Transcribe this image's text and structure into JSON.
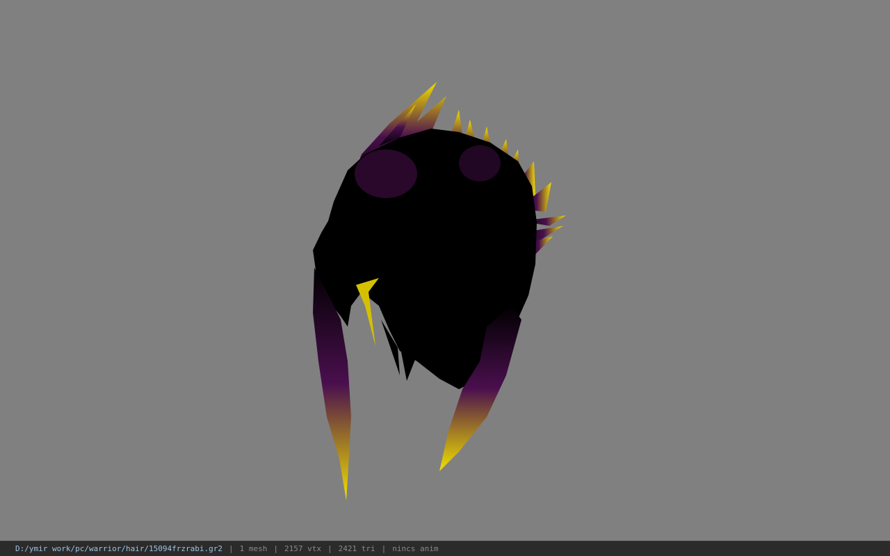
{
  "viewport": {
    "model": "hair-mesh",
    "colors": {
      "background": "#808080",
      "base": "#000000",
      "mid": "#4a0f4e",
      "tip": "#f2e000"
    }
  },
  "status_bar": {
    "path": "D:/ymir work/pc/warrior/hair/15094frzrabi.gr2",
    "separator": "|",
    "mesh": "1 mesh",
    "vtx": "2157 vtx",
    "tri": "2421 tri",
    "anim": "nincs anim"
  }
}
